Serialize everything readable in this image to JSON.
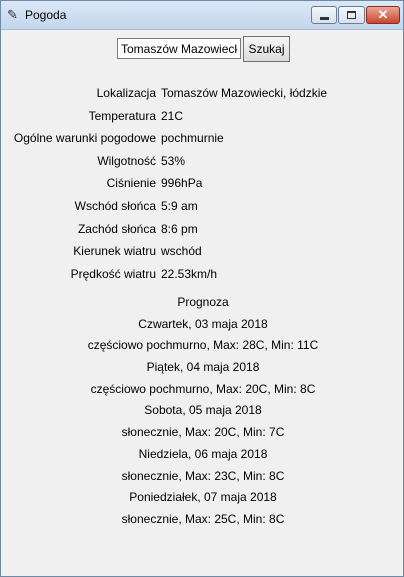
{
  "window": {
    "title": "Pogoda",
    "close_glyph": "✕"
  },
  "search": {
    "value": "Tomaszów Mazowiecki",
    "button_label": "Szukaj"
  },
  "info": [
    {
      "label": "Lokalizacja",
      "value": "Tomaszów Mazowiecki, łódzkie"
    },
    {
      "label": "Temperatura",
      "value": "21C"
    },
    {
      "label": "Ogólne warunki pogodowe",
      "value": "pochmurnie"
    },
    {
      "label": "Wilgotność",
      "value": "53%"
    },
    {
      "label": "Ciśnienie",
      "value": "996hPa"
    },
    {
      "label": "Wschód słońca",
      "value": "5:9 am"
    },
    {
      "label": "Zachód słońca",
      "value": "8:6 pm"
    },
    {
      "label": "Kierunek wiatru",
      "value": "wschód"
    },
    {
      "label": "Prędkość wiatru",
      "value": "22.53km/h"
    }
  ],
  "forecast": {
    "title": "Prognoza",
    "days": [
      {
        "date": "Czwartek, 03 maja 2018",
        "summary": "częściowo pochmurno, Max: 28C, Min: 11C"
      },
      {
        "date": "Piątek, 04 maja 2018",
        "summary": "częściowo pochmurno, Max: 20C, Min: 8C"
      },
      {
        "date": "Sobota, 05 maja 2018",
        "summary": "słonecznie, Max: 20C, Min: 7C"
      },
      {
        "date": "Niedziela, 06 maja 2018",
        "summary": "słonecznie, Max: 23C, Min: 8C"
      },
      {
        "date": "Poniedziałek, 07 maja 2018",
        "summary": "słonecznie, Max: 25C, Min: 8C"
      }
    ]
  }
}
